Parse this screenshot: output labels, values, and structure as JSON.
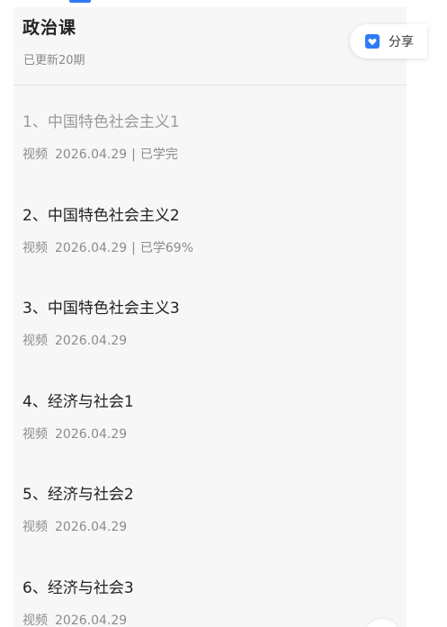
{
  "course": {
    "title": "政治课",
    "update_info": "已更新20期"
  },
  "share": {
    "label": "分享",
    "icon": "bookmark-heart-icon",
    "accent": "#2f7bf5"
  },
  "lessons": [
    {
      "title": "1、中国特色社会主义1",
      "type": "视频",
      "date": "2026.04.29",
      "sep": "|",
      "progress": "已学完",
      "status": "done"
    },
    {
      "title": "2、中国特色社会主义2",
      "type": "视频",
      "date": "2026.04.29",
      "sep": "|",
      "progress": "已学69%",
      "status": "in-progress"
    },
    {
      "title": "3、中国特色社会主义3",
      "type": "视频",
      "date": "2026.04.29",
      "sep": "",
      "progress": "",
      "status": "new"
    },
    {
      "title": "4、经济与社会1",
      "type": "视频",
      "date": "2026.04.29",
      "sep": "",
      "progress": "",
      "status": "new"
    },
    {
      "title": "5、经济与社会2",
      "type": "视频",
      "date": "2026.04.29",
      "sep": "",
      "progress": "",
      "status": "new"
    },
    {
      "title": "6、经济与社会3",
      "type": "视频",
      "date": "2026.04.29",
      "sep": "",
      "progress": "",
      "status": "new"
    }
  ]
}
